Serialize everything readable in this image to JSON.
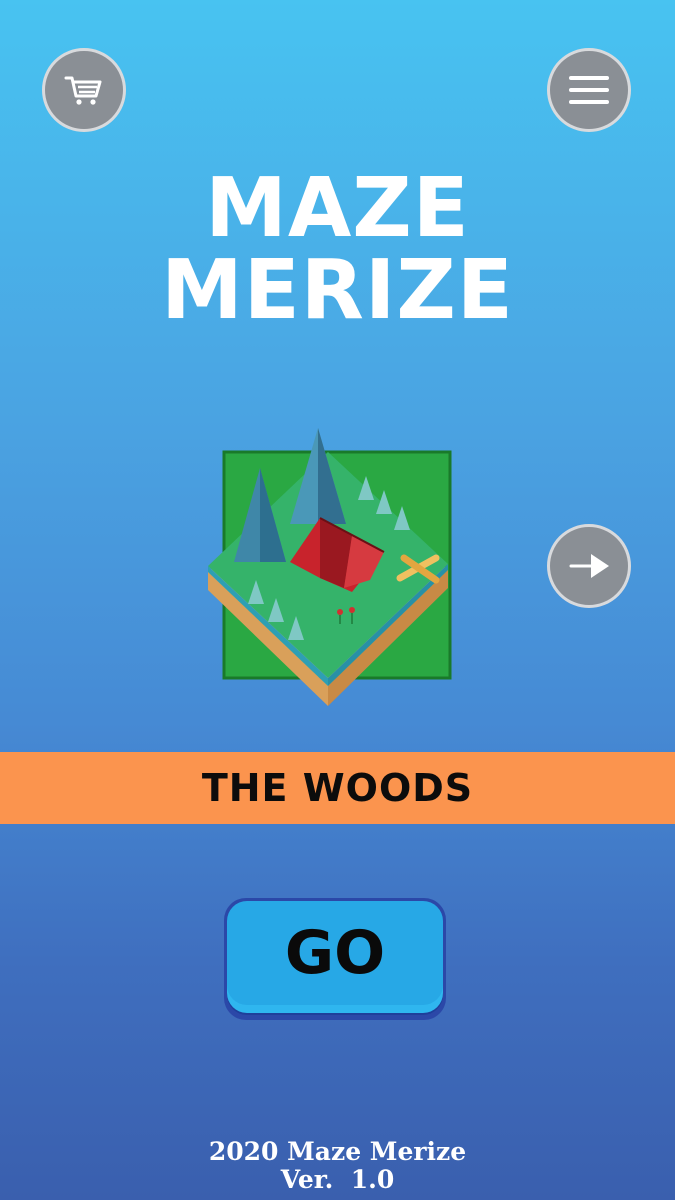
{
  "title": {
    "line1": "MAZE",
    "line2": "MERIZE"
  },
  "buttons": {
    "shop_icon": "shopping-cart-icon",
    "menu_icon": "hamburger-menu-icon",
    "next_icon": "arrow-right-icon"
  },
  "level": {
    "name": "THE WOODS",
    "preview": "forest-camp-island-illustration"
  },
  "play": {
    "label": "GO"
  },
  "footer": {
    "copyright": "2020 Maze Merize",
    "version": "Ver.  1.0"
  },
  "colors": {
    "banner": "#fb944e",
    "go_button": "#27a8e6",
    "icon_button": "#8a8f95"
  }
}
